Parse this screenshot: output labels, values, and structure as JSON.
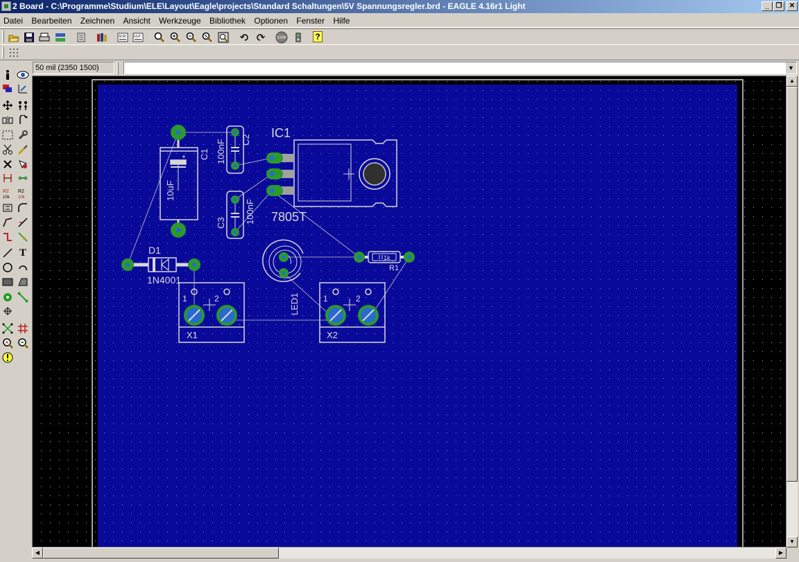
{
  "window": {
    "title": "2 Board - C:\\Programme\\Studium\\ELE\\Layout\\Eagle\\projects\\Standard Schaltungen\\5V Spannungsregler.brd - EAGLE 4.16r1 Light",
    "controls": {
      "minimize": "_",
      "restore": "❐",
      "close": "✕"
    }
  },
  "menu": [
    "Datei",
    "Bearbeiten",
    "Zeichnen",
    "Ansicht",
    "Werkzeuge",
    "Bibliothek",
    "Optionen",
    "Fenster",
    "Hilfe"
  ],
  "toolbar": {
    "icons": [
      "open-icon",
      "save-icon",
      "print-icon",
      "cam-icon",
      "board-schematic-icon",
      "library-icon",
      "script-icon",
      "ulp-icon",
      "zoom-fit-icon",
      "zoom-in-icon",
      "zoom-out-icon",
      "redraw-icon",
      "zoom-select-icon",
      "undo-icon",
      "redo-icon",
      "stop-icon",
      "go-icon",
      "help-icon"
    ],
    "stop_label": "STOP",
    "help_label": "?"
  },
  "coords": {
    "display": "50 mil (2350 1500)"
  },
  "command": {
    "value": ""
  },
  "board": {
    "background": "#0a0a9a",
    "components": {
      "ic1_name": "IC1",
      "ic1_value": "7805T",
      "c1_name": "C1",
      "c1_value": "10uF",
      "c2_name": "C2",
      "c2_value": "100nF",
      "c3_name": "C3",
      "c3_value": "100nF",
      "d1_name": "D1",
      "d1_value": "1N4001",
      "led_name": "LED1",
      "r1_name": "R1",
      "r1_value": "1k",
      "x1_name": "X1",
      "x2_name": "X2",
      "pin1": "1",
      "pin2": "2"
    }
  },
  "colors": {
    "title_start": "#0a246a",
    "title_end": "#a6caf0",
    "pad": "#2a9a2a",
    "silk": "#d8d8d8",
    "airwire": "#c8c8c8"
  }
}
